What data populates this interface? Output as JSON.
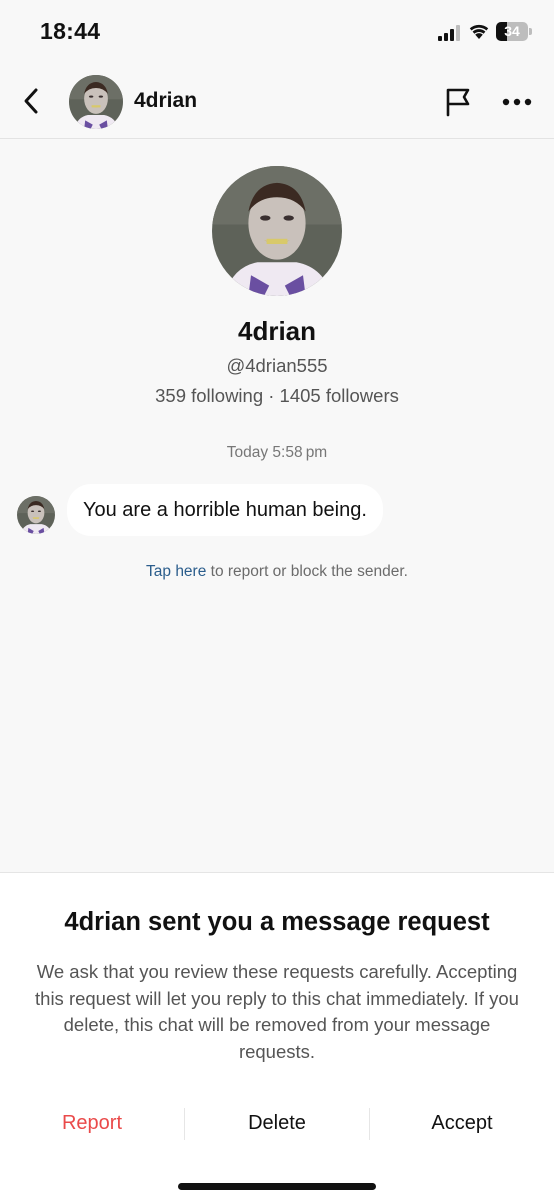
{
  "status_bar": {
    "time": "18:44",
    "battery_percent": "34"
  },
  "header": {
    "name": "4drian"
  },
  "profile": {
    "name": "4drian",
    "handle": "@4drian555",
    "stats": "359 following · 1405 followers"
  },
  "chat": {
    "timestamp": "Today 5:58 pm",
    "message": "You are a horrible human being.",
    "tap_here": "Tap here",
    "report_hint_rest": " to report or block the sender."
  },
  "sheet": {
    "title": "4drian sent you a message request",
    "description": "We ask that you review these requests carefully. Accepting this request will let you reply to this chat immediately. If you delete, this chat will be removed from your message requests.",
    "report_label": "Report",
    "delete_label": "Delete",
    "accept_label": "Accept"
  },
  "colors": {
    "report_red": "#ea4a4a",
    "link_blue": "#2b5d8c",
    "background": "#f8f8f8"
  },
  "icons": {
    "back": "chevron-left-icon",
    "flag": "flag-icon",
    "more": "more-horizontal-icon",
    "signal": "cellular-signal-icon",
    "wifi": "wifi-icon",
    "battery": "battery-icon"
  }
}
